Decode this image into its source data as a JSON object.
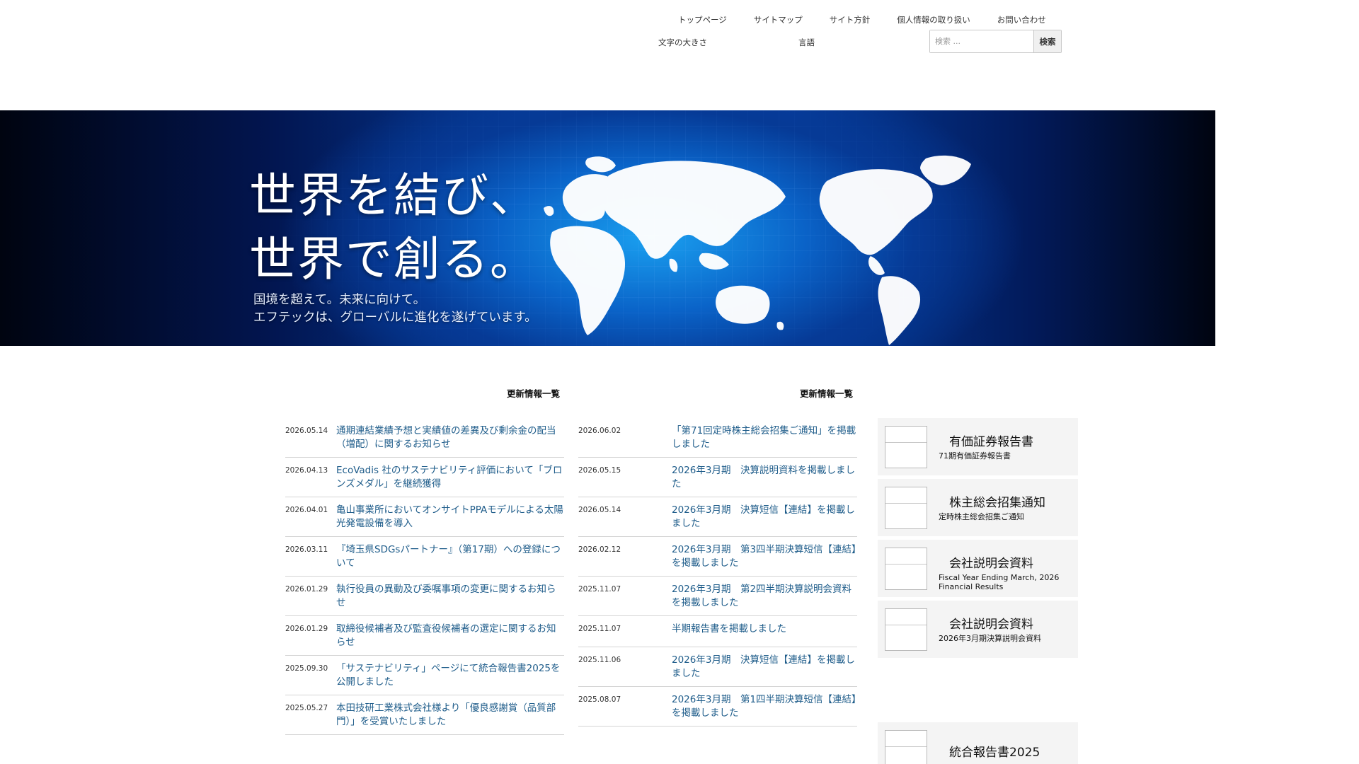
{
  "header": {
    "nav": [
      "トップページ",
      "サイトマップ",
      "サイト方針",
      "個人情報の取り扱い",
      "お問い合わせ"
    ],
    "font_size_label": "文字の大きさ",
    "language_label": "言語",
    "search": {
      "placeholder": "検索 ...",
      "button": "検索"
    }
  },
  "hero": {
    "title_line1": "世界を結び、",
    "title_line2": "世界で創る。",
    "sub_line1": "国境を超えて。未来に向けて。",
    "sub_line2": "エフテックは、グローバルに進化を遂げています。"
  },
  "news_left": {
    "heading": "更新情報一覧",
    "items": [
      {
        "date": "2026.05.14",
        "title": "通期連結業績予想と実績値の差異及び剰余金の配当（増配）に関するお知らせ"
      },
      {
        "date": "2026.04.13",
        "title": "EcoVadis 社のサステナビリティ評価において「ブロンズメダル」を継続獲得"
      },
      {
        "date": "2026.04.01",
        "title": "亀山事業所においてオンサイトPPAモデルによる太陽光発電設備を導入"
      },
      {
        "date": "2026.03.11",
        "title": "『埼玉県SDGsパートナー』（第17期）への登録について"
      },
      {
        "date": "2026.01.29",
        "title": "執行役員の異動及び委嘱事項の変更に関するお知らせ"
      },
      {
        "date": "2026.01.29",
        "title": "取締役候補者及び監査役候補者の選定に関するお知らせ"
      },
      {
        "date": "2025.09.30",
        "title": "「サステナビリティ」ページにて統合報告書2025を公開しました"
      },
      {
        "date": "2025.05.27",
        "title": "本田技研工業株式会社様より「優良感謝賞（品質部門）」を受賞いたしました"
      }
    ]
  },
  "news_right": {
    "heading": "更新情報一覧",
    "items": [
      {
        "date": "2026.06.02",
        "title": "「第71回定時株主総会招集ご通知」を掲載しました"
      },
      {
        "date": "2026.05.15",
        "title": "2026年3月期　決算説明資料を掲載しました"
      },
      {
        "date": "2026.05.14",
        "title": "2026年3月期　決算短信【連結】を掲載しました"
      },
      {
        "date": "2026.02.12",
        "title": "2026年3月期　第3四半期決算短信【連結】を掲載しました"
      },
      {
        "date": "2025.11.07",
        "title": "2026年3月期　第2四半期決算説明会資料を掲載しました"
      },
      {
        "date": "2025.11.07",
        "title": "半期報告書を掲載しました"
      },
      {
        "date": "2025.11.06",
        "title": "2026年3月期　決算短信【連結】を掲載しました"
      },
      {
        "date": "2025.08.07",
        "title": "2026年3月期　第1四半期決算短信【連結】を掲載しました"
      }
    ]
  },
  "sidebar": {
    "cards": [
      {
        "title": "有価証券報告書",
        "sub": "71期有価証券報告書"
      },
      {
        "title": "株主総会招集通知",
        "sub": "定時株主総会招集ご通知"
      },
      {
        "title": "会社説明会資料",
        "sub": "Fiscal Year Ending March, 2026 Financial Results"
      },
      {
        "title": "会社説明会資料",
        "sub": "2026年3月期決算説明会資料"
      },
      {
        "title": "統合報告書2025",
        "sub": ""
      }
    ]
  }
}
